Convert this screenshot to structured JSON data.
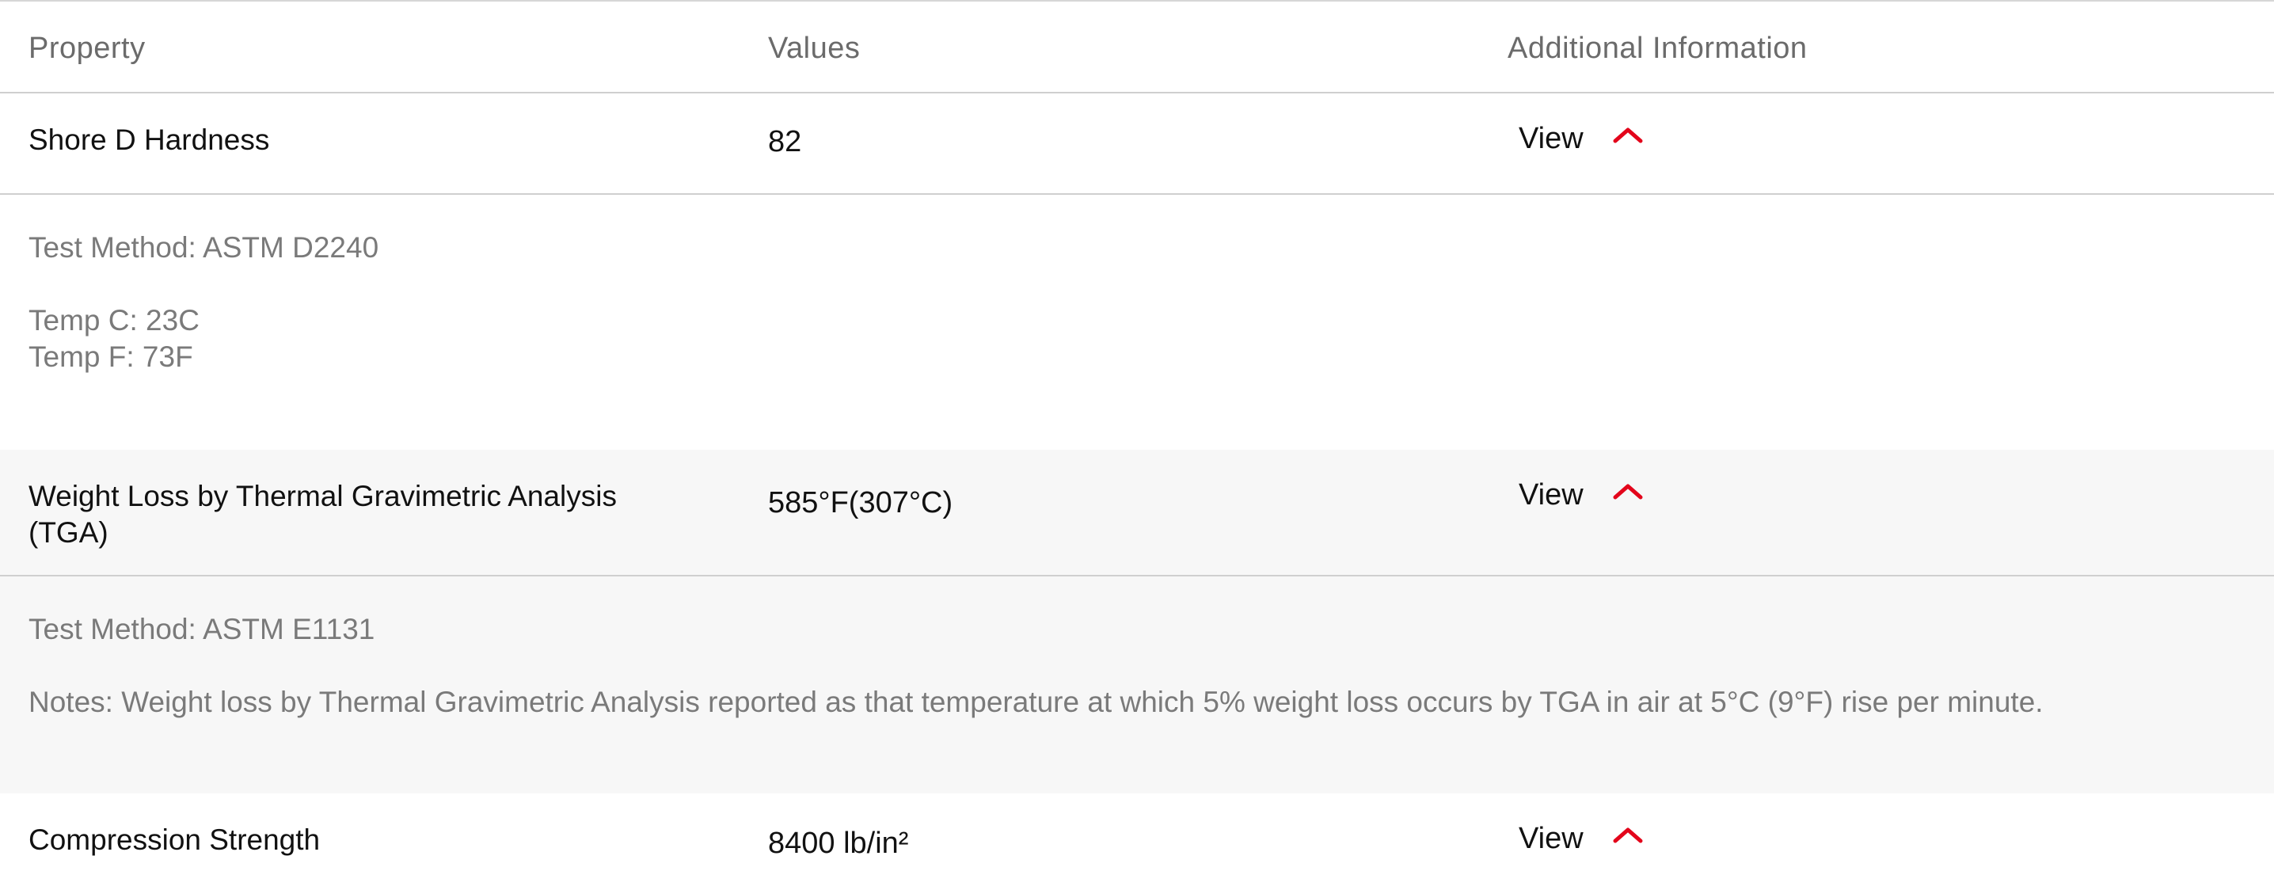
{
  "header": {
    "property": "Property",
    "values": "Values",
    "additional_information": "Additional Information"
  },
  "rows": [
    {
      "property": "Shore D Hardness",
      "value": "82",
      "view_label": "View",
      "expanded": true,
      "details": {
        "test_method": "Test Method: ASTM D2240",
        "temp_c": "Temp C: 23C",
        "temp_f": "Temp F: 73F"
      }
    },
    {
      "property_line1": "Weight Loss by Thermal Gravimetric Analysis",
      "property_line2": "(TGA)",
      "value": "585°F(307°C)",
      "view_label": "View",
      "expanded": true,
      "details": {
        "test_method": "Test Method: ASTM E1131",
        "notes": "Notes: Weight loss by Thermal Gravimetric Analysis reported as that temperature at which 5% weight loss occurs by TGA in air at 5°C (9°F) rise per minute."
      }
    },
    {
      "property": "Compression Strength",
      "value": "8400 lb/in²",
      "view_label": "View",
      "expanded": true
    }
  ],
  "colors": {
    "accent": "#e3051b",
    "row_alt_bg": "#f7f7f7",
    "border": "#cfcfcf",
    "detail_text": "#7a7a7a"
  },
  "icons": {
    "collapse": "chevron-up-icon"
  }
}
